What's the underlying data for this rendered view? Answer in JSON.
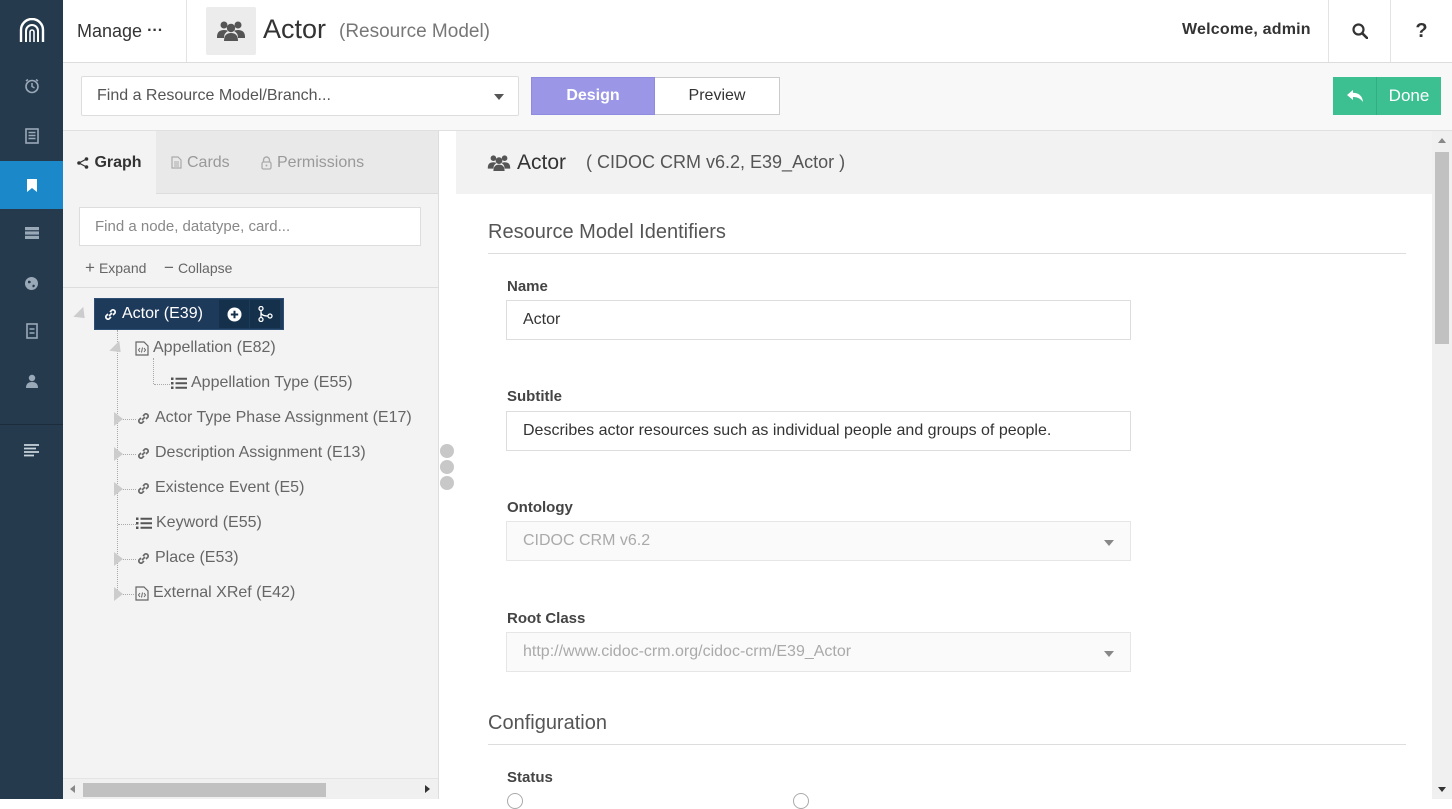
{
  "header": {
    "manage_label": "Manage",
    "manage_dots": "···",
    "model_title": "Actor",
    "model_subtitle": "(Resource Model)",
    "welcome": "Welcome, admin",
    "help_label": "?"
  },
  "toolbar": {
    "model_finder_placeholder": "Find a Resource Model/Branch...",
    "design_label": "Design",
    "preview_label": "Preview",
    "done_label": "Done"
  },
  "left_panel": {
    "tabs": [
      {
        "label": "Graph",
        "active": true
      },
      {
        "label": "Cards",
        "active": false
      },
      {
        "label": "Permissions",
        "active": false
      }
    ],
    "node_search_placeholder": "Find a node, datatype, card...",
    "expand_label": "Expand",
    "collapse_label": "Collapse",
    "tree": {
      "root": "Actor (E39)",
      "nodes": [
        {
          "label": "Appellation (E82)",
          "icon": "semantic-node-icon",
          "level": 1
        },
        {
          "label": "Appellation Type (E55)",
          "icon": "concept-list-icon",
          "level": 2
        },
        {
          "label": "Actor Type Phase Assignment (E17)",
          "icon": "link-icon",
          "level": 1
        },
        {
          "label": "Description Assignment (E13)",
          "icon": "link-icon",
          "level": 1
        },
        {
          "label": "Existence Event (E5)",
          "icon": "link-icon",
          "level": 1
        },
        {
          "label": "Keyword (E55)",
          "icon": "concept-list-icon",
          "level": 1
        },
        {
          "label": "Place (E53)",
          "icon": "link-icon",
          "level": 1
        },
        {
          "label": "External XRef (E42)",
          "icon": "semantic-node-icon",
          "level": 1
        }
      ]
    }
  },
  "right_panel": {
    "title": "Actor",
    "ontology_info": "( CIDOC CRM v6.2, E39_Actor )",
    "identifiers_section": "Resource Model Identifiers",
    "name_label": "Name",
    "name_value": "Actor",
    "subtitle_label": "Subtitle",
    "subtitle_value": "Describes actor resources such as individual people and groups of people.",
    "ontology_label": "Ontology",
    "ontology_value": "CIDOC CRM v6.2",
    "root_class_label": "Root Class",
    "root_class_value": "http://www.cidoc-crm.org/cidoc-crm/E39_Actor",
    "configuration_section": "Configuration",
    "status_label": "Status"
  },
  "colors": {
    "rail_bg": "#263a4e",
    "rail_active": "#1a88c9",
    "design_active": "#9b97e6",
    "done_green": "#3cbf91",
    "root_node_bg": "#1e3a5a"
  }
}
